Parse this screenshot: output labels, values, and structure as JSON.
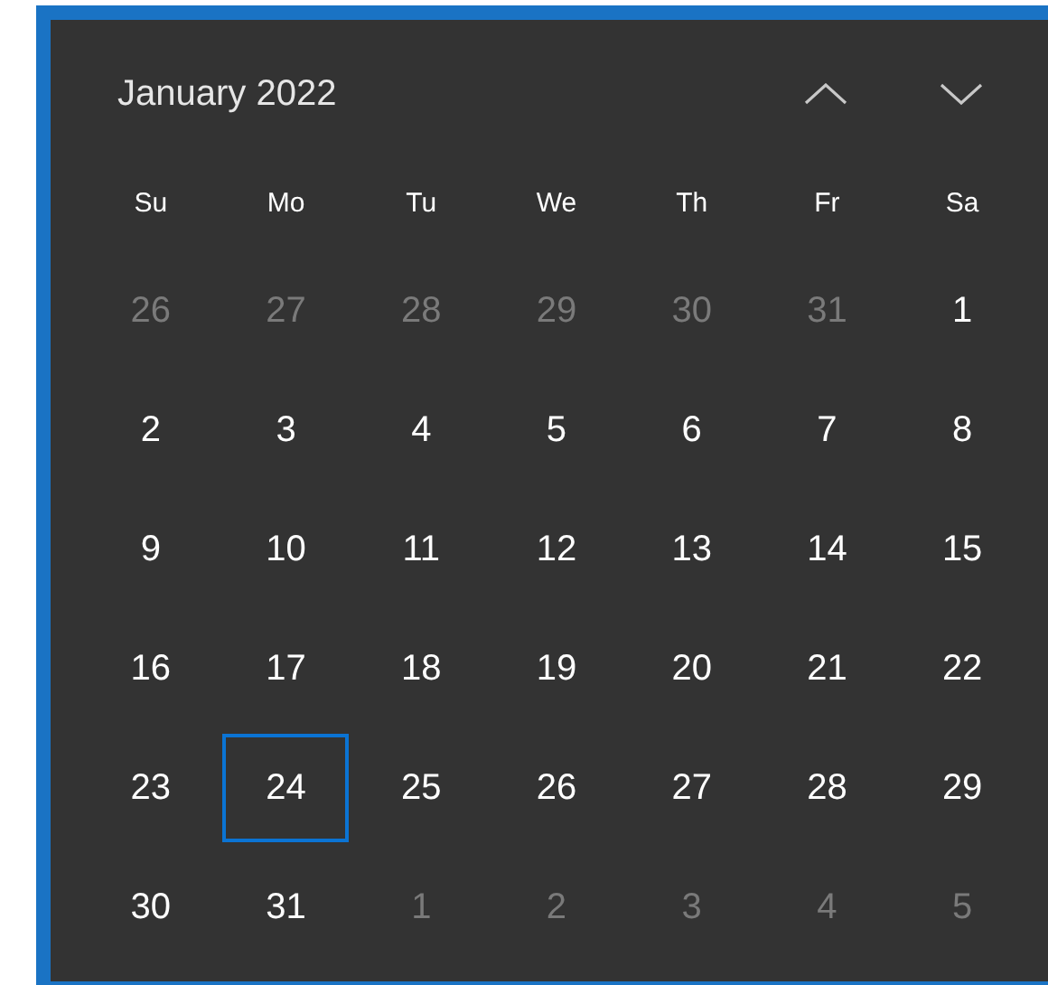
{
  "title": "January 2022",
  "nav": [
    {
      "kind": "up"
    },
    {
      "kind": "down"
    }
  ],
  "weekdays": [
    "Su",
    "Mo",
    "Tu",
    "We",
    "Th",
    "Fr",
    "Sa"
  ],
  "weeks": [
    [
      {
        "day": "26",
        "in_month": false,
        "selected": false
      },
      {
        "day": "27",
        "in_month": false,
        "selected": false
      },
      {
        "day": "28",
        "in_month": false,
        "selected": false
      },
      {
        "day": "29",
        "in_month": false,
        "selected": false
      },
      {
        "day": "30",
        "in_month": false,
        "selected": false
      },
      {
        "day": "31",
        "in_month": false,
        "selected": false
      },
      {
        "day": "1",
        "in_month": true,
        "selected": false
      }
    ],
    [
      {
        "day": "2",
        "in_month": true,
        "selected": false
      },
      {
        "day": "3",
        "in_month": true,
        "selected": false
      },
      {
        "day": "4",
        "in_month": true,
        "selected": false
      },
      {
        "day": "5",
        "in_month": true,
        "selected": false
      },
      {
        "day": "6",
        "in_month": true,
        "selected": false
      },
      {
        "day": "7",
        "in_month": true,
        "selected": false
      },
      {
        "day": "8",
        "in_month": true,
        "selected": false
      }
    ],
    [
      {
        "day": "9",
        "in_month": true,
        "selected": false
      },
      {
        "day": "10",
        "in_month": true,
        "selected": false
      },
      {
        "day": "11",
        "in_month": true,
        "selected": false
      },
      {
        "day": "12",
        "in_month": true,
        "selected": false
      },
      {
        "day": "13",
        "in_month": true,
        "selected": false
      },
      {
        "day": "14",
        "in_month": true,
        "selected": false
      },
      {
        "day": "15",
        "in_month": true,
        "selected": false
      }
    ],
    [
      {
        "day": "16",
        "in_month": true,
        "selected": false
      },
      {
        "day": "17",
        "in_month": true,
        "selected": false
      },
      {
        "day": "18",
        "in_month": true,
        "selected": false
      },
      {
        "day": "19",
        "in_month": true,
        "selected": false
      },
      {
        "day": "20",
        "in_month": true,
        "selected": false
      },
      {
        "day": "21",
        "in_month": true,
        "selected": false
      },
      {
        "day": "22",
        "in_month": true,
        "selected": false
      }
    ],
    [
      {
        "day": "23",
        "in_month": true,
        "selected": false
      },
      {
        "day": "24",
        "in_month": true,
        "selected": true
      },
      {
        "day": "25",
        "in_month": true,
        "selected": false
      },
      {
        "day": "26",
        "in_month": true,
        "selected": false
      },
      {
        "day": "27",
        "in_month": true,
        "selected": false
      },
      {
        "day": "28",
        "in_month": true,
        "selected": false
      },
      {
        "day": "29",
        "in_month": true,
        "selected": false
      }
    ],
    [
      {
        "day": "30",
        "in_month": true,
        "selected": false
      },
      {
        "day": "31",
        "in_month": true,
        "selected": false
      },
      {
        "day": "1",
        "in_month": false,
        "selected": false
      },
      {
        "day": "2",
        "in_month": false,
        "selected": false
      },
      {
        "day": "3",
        "in_month": false,
        "selected": false
      },
      {
        "day": "4",
        "in_month": false,
        "selected": false
      },
      {
        "day": "5",
        "in_month": false,
        "selected": false
      }
    ]
  ]
}
